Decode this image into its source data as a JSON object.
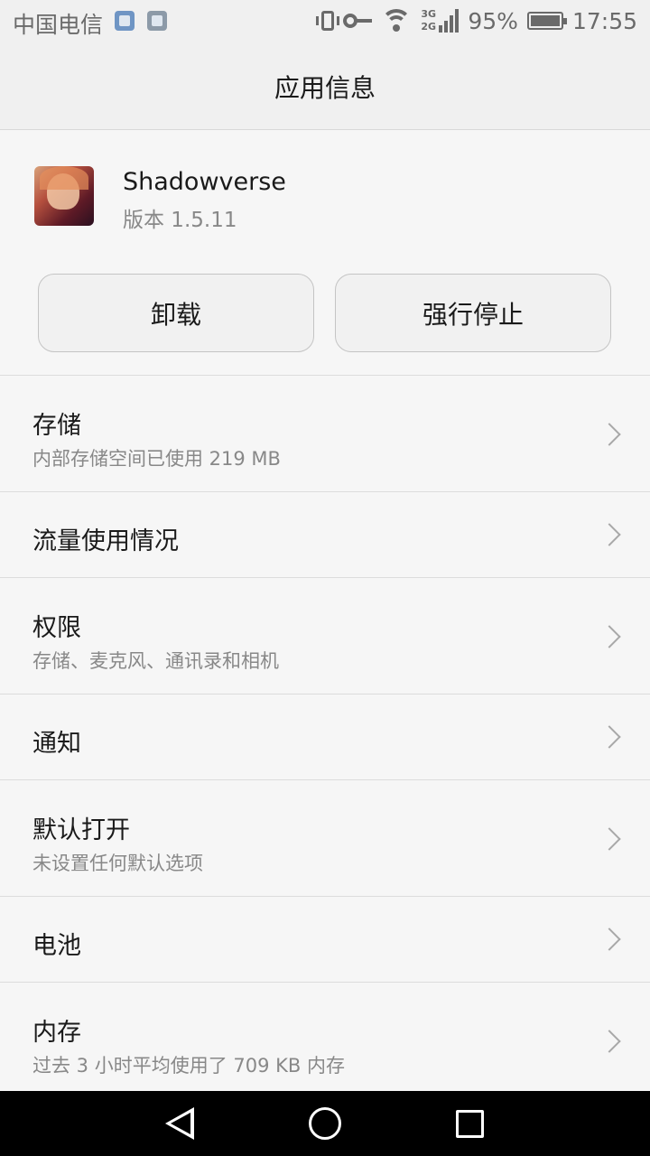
{
  "status_bar": {
    "carrier": "中国电信",
    "network_labels": [
      "3G",
      "2G"
    ],
    "battery": "95%",
    "time": "17:55"
  },
  "header": {
    "title": "应用信息"
  },
  "app": {
    "name": "Shadowverse",
    "version": "版本 1.5.11"
  },
  "actions": {
    "uninstall": "卸载",
    "force_stop": "强行停止"
  },
  "list": [
    {
      "title": "存储",
      "subtitle": "内部存储空间已使用 219 MB"
    },
    {
      "title": "流量使用情况"
    },
    {
      "title": "权限",
      "subtitle": "存储、麦克风、通讯录和相机"
    },
    {
      "title": "通知"
    },
    {
      "title": "默认打开",
      "subtitle": "未设置任何默认选项"
    },
    {
      "title": "电池"
    },
    {
      "title": "内存",
      "subtitle": "过去 3 小时平均使用了 709 KB 内存"
    }
  ]
}
